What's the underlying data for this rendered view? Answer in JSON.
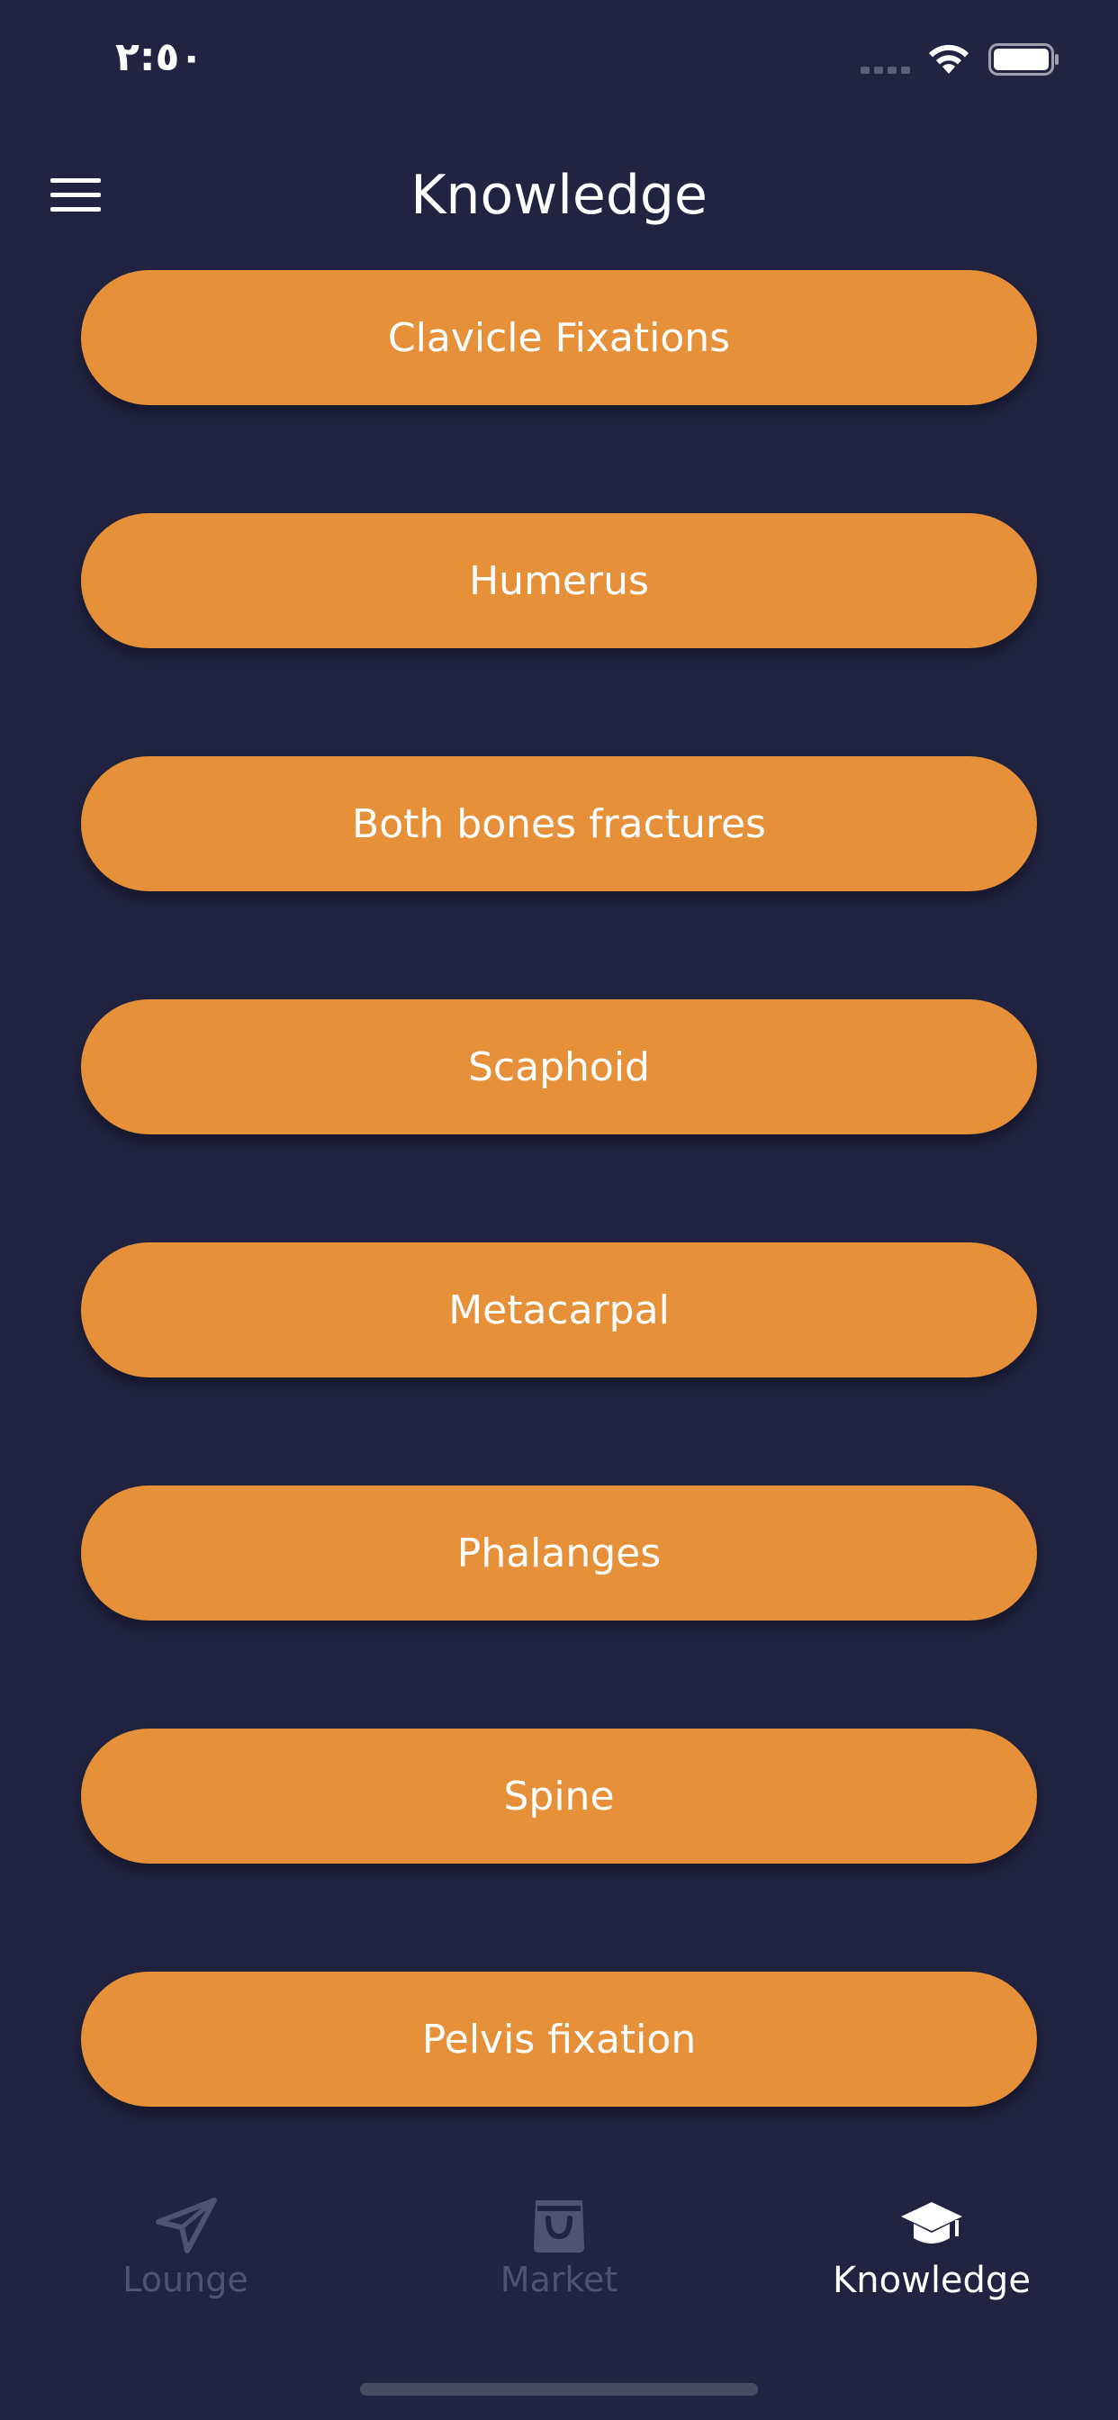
{
  "status_bar": {
    "time": "٢:٥٠"
  },
  "header": {
    "title": "Knowledge",
    "menu_icon": "hamburger-menu-icon"
  },
  "knowledge_items": [
    {
      "label": "Clavicle Fixations"
    },
    {
      "label": "Humerus"
    },
    {
      "label": "Both bones fractures"
    },
    {
      "label": "Scaphoid"
    },
    {
      "label": "Metacarpal"
    },
    {
      "label": "Phalanges"
    },
    {
      "label": "Spine"
    },
    {
      "label": "Pelvis fixation"
    }
  ],
  "tabs": [
    {
      "label": "Lounge",
      "icon": "send-arrow-icon",
      "active": false
    },
    {
      "label": "Market",
      "icon": "shopping-bag-icon",
      "active": false
    },
    {
      "label": "Knowledge",
      "icon": "graduation-cap-icon",
      "active": true
    }
  ],
  "colors": {
    "background": "#212341",
    "button": "#E6913A",
    "text": "#FFFFFF",
    "inactive_tab": "#4F5270"
  }
}
